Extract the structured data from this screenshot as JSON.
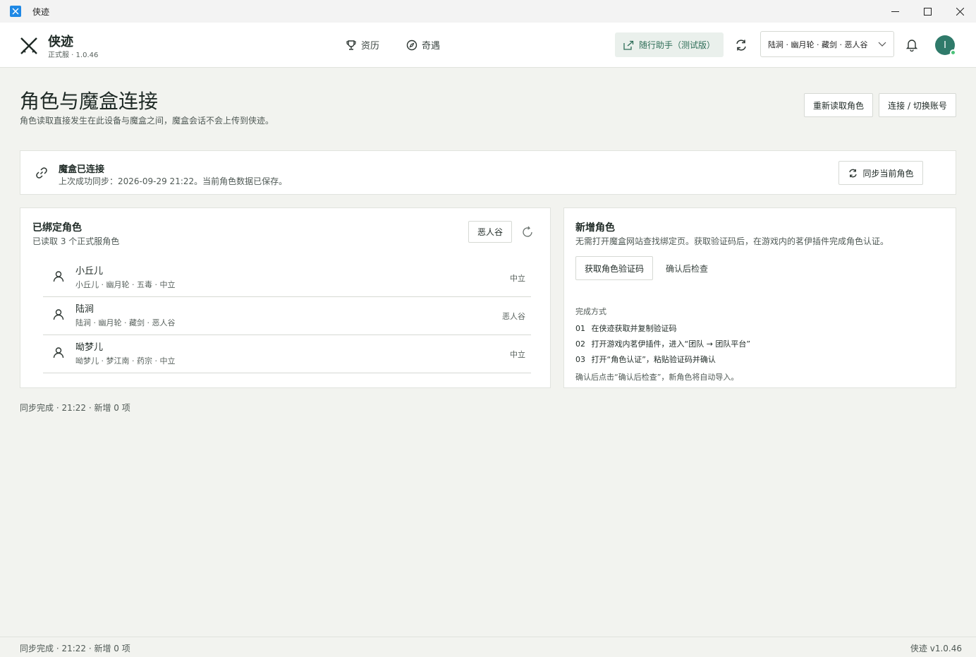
{
  "window": {
    "title": "侠迹"
  },
  "header": {
    "brand_name": "侠迹",
    "brand_version": "正式服 · 1.0.46",
    "nav": [
      {
        "label": "资历",
        "icon": "trophy-icon"
      },
      {
        "label": "奇遇",
        "icon": "compass-icon"
      }
    ],
    "assistant_label": "随行助手（测试版）",
    "role_selected": "陆涧 · 幽月轮 · 藏剑 · 恶人谷",
    "avatar_initial": "I"
  },
  "page": {
    "title": "角色与魔盒连接",
    "subtitle": "角色读取直接发生在此设备与魔盒之间，魔盒会话不会上传到侠迹。",
    "reload_label": "重新读取角色",
    "switch_label": "连接 / 切换账号"
  },
  "connection": {
    "title": "魔盒已连接",
    "subtitle": "上次成功同步：2026-09-29 21:22。当前角色数据已保存。",
    "sync_label": "同步当前角色"
  },
  "bound": {
    "title": "已绑定角色",
    "subtitle": "已读取 3 个正式服角色",
    "filter_label": "恶人谷",
    "characters": [
      {
        "name": "小丘儿",
        "meta": "小丘儿 · 幽月轮 · 五毒 · 中立",
        "camp": "中立"
      },
      {
        "name": "陆涧",
        "meta": "陆涧 · 幽月轮 · 藏剑 · 恶人谷",
        "camp": "恶人谷"
      },
      {
        "name": "呦梦儿",
        "meta": "呦梦儿 · 梦江南 · 药宗 · 中立",
        "camp": "中立"
      }
    ]
  },
  "new_role": {
    "title": "新增角色",
    "subtitle": "无需打开魔盒网站查找绑定页。获取验证码后，在游戏内的茗伊插件完成角色认证。",
    "get_code_label": "获取角色验证码",
    "check_label": "确认后检查",
    "steps_label": "完成方式",
    "steps": [
      {
        "num": "01",
        "text": "在侠迹获取并复制验证码"
      },
      {
        "num": "02",
        "text": "打开游戏内茗伊插件，进入“团队 → 团队平台”"
      },
      {
        "num": "03",
        "text": "打开“角色认证”，粘贴验证码并确认"
      }
    ],
    "note": "确认后点击“确认后检查”，新角色将自动导入。"
  },
  "status": {
    "sync": "同步完成 · 21:22 · 新增 0 项"
  },
  "footer": {
    "left": "同步完成 · 21:22 · 新增 0 项",
    "right": "侠迹 v1.0.46"
  }
}
